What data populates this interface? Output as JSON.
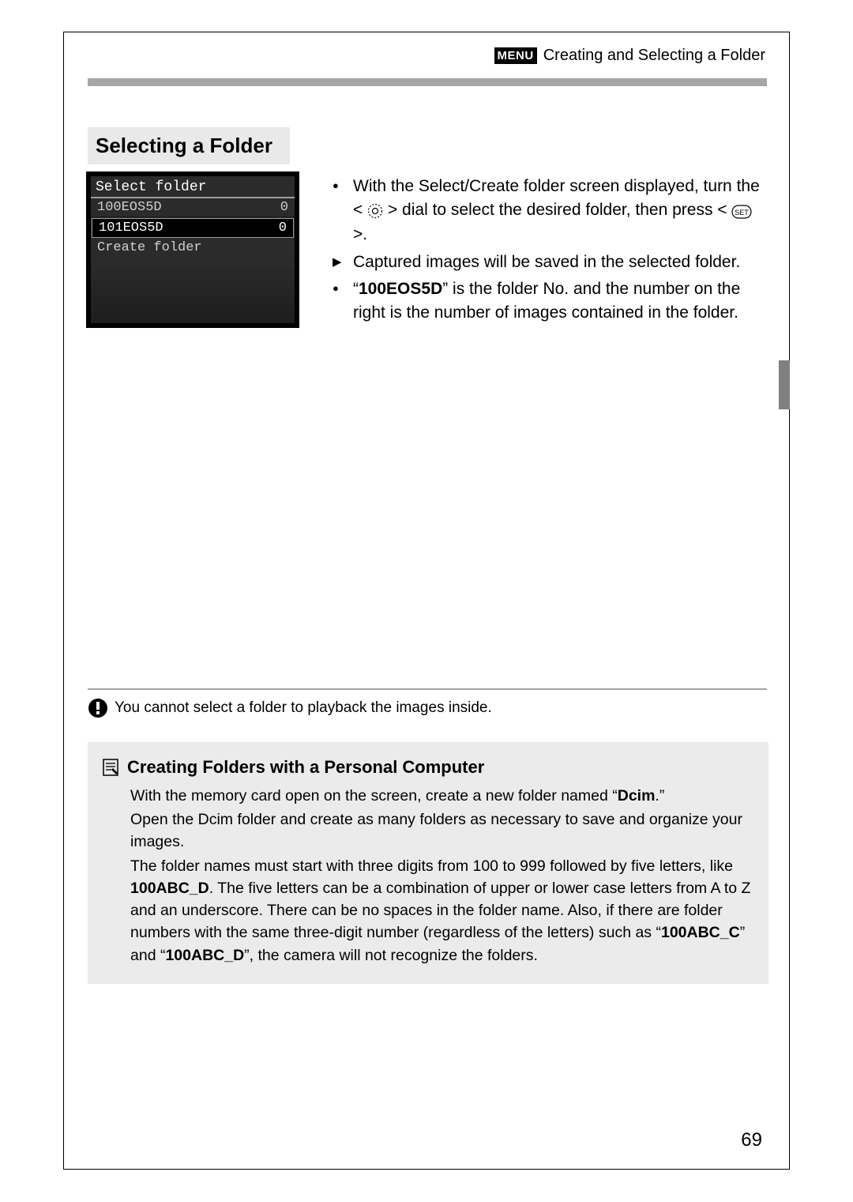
{
  "header": {
    "menu_label": "MENU",
    "breadcrumb": "Creating and Selecting a Folder"
  },
  "section": {
    "title": "Selecting a Folder"
  },
  "lcd": {
    "title": "Select folder",
    "rows": [
      {
        "name": "100EOS5D",
        "count": "0"
      },
      {
        "name": "101EOS5D",
        "count": "0"
      }
    ],
    "create_label": "Create folder"
  },
  "bullets": {
    "b1_a": "With the Select/Create folder screen displayed, turn the <",
    "b1_b": "> dial to select the desired folder, then press <",
    "b1_c": ">.",
    "b2": "Captured images will be saved in the selected folder.",
    "b3_a": "“",
    "b3_bold": "100EOS5D",
    "b3_b": "” is the folder No. and the number on the right is the number of images contained in the folder."
  },
  "caution": {
    "text": "You cannot select a folder to playback the images inside."
  },
  "greybox": {
    "title": "Creating Folders with a Personal Computer",
    "p1_a": "With the memory card open on the screen, create a new folder named “",
    "p1_bold": "Dcim",
    "p1_b": ".”",
    "p2": "Open the Dcim folder and create as many folders as necessary to save and organize your images.",
    "p3_a": "The folder names must start with three digits from 100 to 999 followed by five letters, like ",
    "p3_bold1": "100ABC_D",
    "p3_b": ". The five letters can be a combination of upper or lower case letters from A to Z and an underscore. There can be no spaces in the folder name. Also, if there are folder numbers with the same three-digit number (regardless of the letters) such as “",
    "p3_bold2": "100ABC_C",
    "p3_c": "” and “",
    "p3_bold3": "100ABC_D",
    "p3_d": "”, the camera will not recognize the folders."
  },
  "page_number": "69"
}
